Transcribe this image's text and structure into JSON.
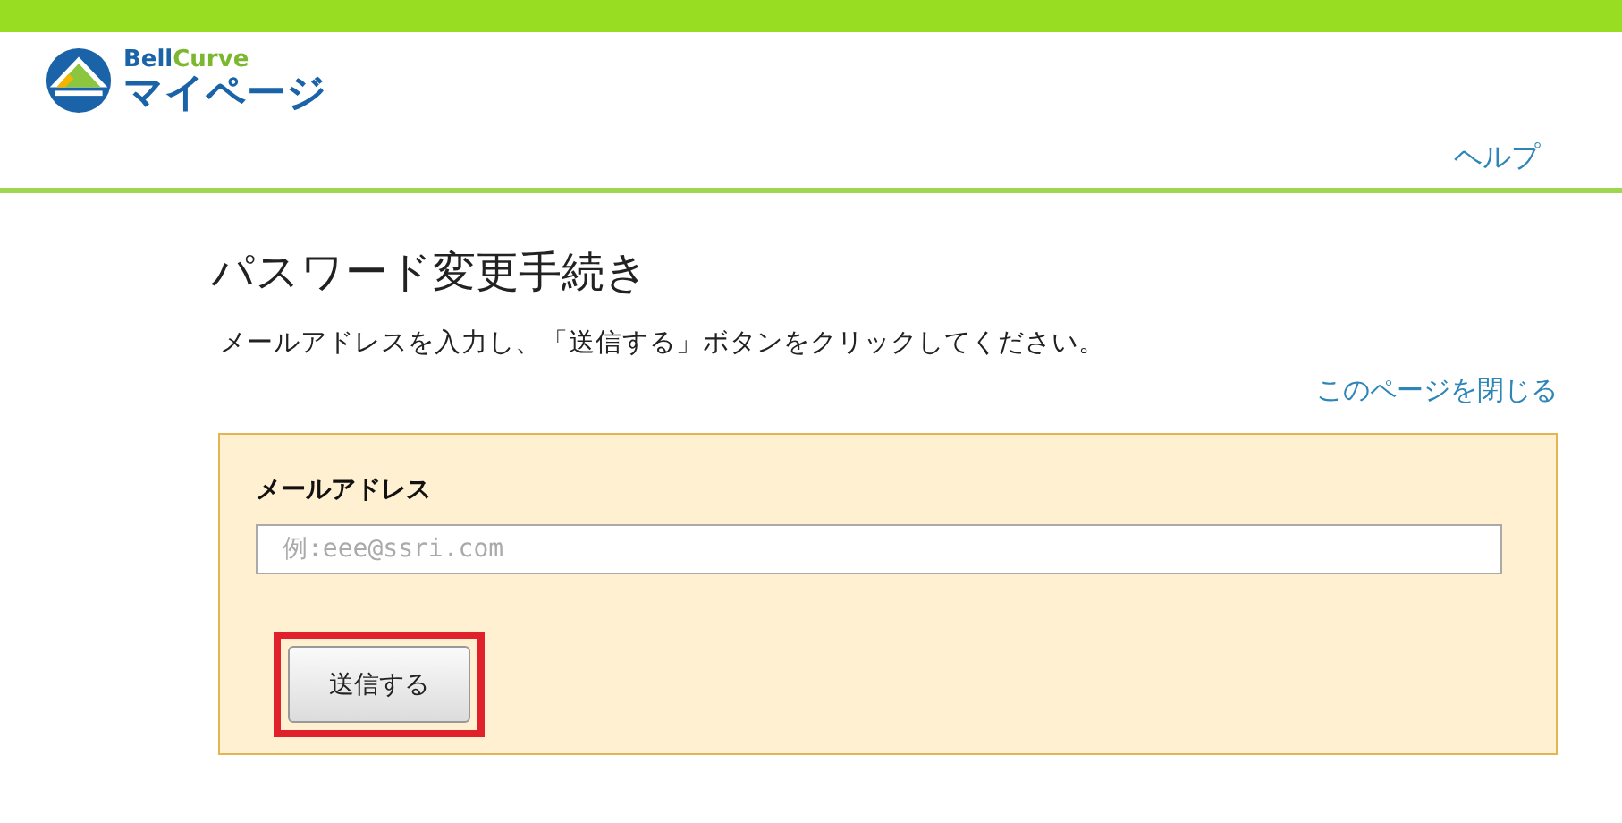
{
  "logo": {
    "brand_main": "Bell",
    "brand_accent": "Curve",
    "subtitle": "マイページ"
  },
  "header": {
    "help_link": "ヘルプ"
  },
  "title": "パスワード変更手続き",
  "instruction": "メールアドレスを入力し、「送信する」ボタンをクリックしてください。",
  "close_link": "このページを閉じる",
  "form": {
    "email_label": "メールアドレス",
    "email_placeholder": "例:eee@ssri.com",
    "submit_button": "送信する",
    "submit_highlighted": true
  }
}
